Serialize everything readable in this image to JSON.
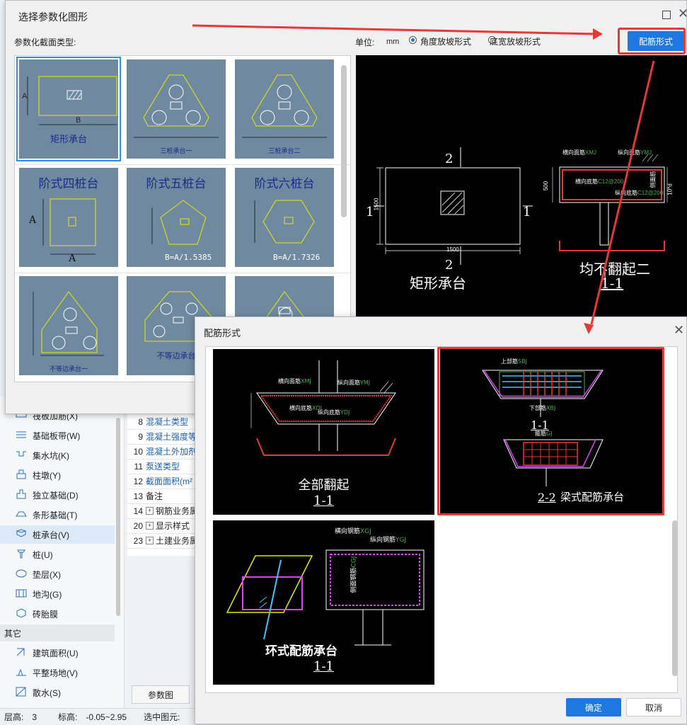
{
  "dialog1": {
    "title": "选择参数化图形",
    "section_type_label": "参数化截面类型:",
    "unit_label": "单位:",
    "unit_value": "mm",
    "radio_angle": "角度放坡形式",
    "radio_width": "底宽放坡形式",
    "rebar_button": "配筋形式",
    "thumbs": [
      {
        "label": "矩形承台",
        "dim_a": "A",
        "dim_b": "B"
      },
      {
        "label": "三桩承台一"
      },
      {
        "label": "三桩承台二"
      },
      {
        "label": "阶式四桩台",
        "dim": "A"
      },
      {
        "label": "阶式五桩台",
        "formula": "B=A/1.5385"
      },
      {
        "label": "阶式六桩台",
        "formula": "B=A/1.7326"
      },
      {
        "label": "不等边承台一"
      },
      {
        "label": "不等边承台"
      },
      {
        "label": ""
      }
    ],
    "preview": {
      "left_title": "矩形承台",
      "sec2_top": "2",
      "sec2_bottom": "2",
      "sec1_left": "1",
      "sec1_right": "1",
      "width_dim": "1500",
      "height_dim": "1500",
      "right_title": "均不翻起二",
      "right_sub": "1-1",
      "lbl_hmj": "横向面筋",
      "lbl_hmj_code": "XMJ",
      "lbl_zmj": "纵向面筋",
      "lbl_zmj_code": "YMJ",
      "lbl_hdj": "横向底筋",
      "lbl_hdj_code": "C12@200",
      "lbl_zdj": "纵向底筋",
      "lbl_zdj_code": "C12@200",
      "dim_500": "500",
      "dim_side": "侧面筋",
      "dim_10d": "10*d"
    }
  },
  "dialog2": {
    "title": "配筋形式",
    "ok": "确定",
    "cancel": "取消",
    "opt1": {
      "title": "全部翻起",
      "sub": "1-1",
      "lbl1": "横向面筋",
      "code1": "XMJ",
      "lbl2": "纵向面筋",
      "code2": "YMJ",
      "lbl3": "横向底筋",
      "code3": "XDJ",
      "lbl4": "纵向底筋",
      "code4": "YDJ"
    },
    "opt2": {
      "title": "梁式配筋承台",
      "sub1": "1-1",
      "sub2": "2-2",
      "lbl_top": "上部筋",
      "code_top": "SBJ",
      "lbl_bottom": "下部筋",
      "code_bottom": "XBJ",
      "lbl_tie": "箍筋",
      "code_tie": "GJ"
    },
    "opt3": {
      "title": "环式配筋承台",
      "sub": "1-1",
      "lbl1": "横向钢筋",
      "code1": "XGJ",
      "lbl2": "纵向钢筋",
      "code2": "YGJ",
      "lbl3": "侧面钢筋",
      "code3": "CGJ"
    }
  },
  "sidebar": {
    "items": [
      {
        "label": "筏板加筋(X)"
      },
      {
        "label": "基础板带(W)"
      },
      {
        "label": "集水坑(K)"
      },
      {
        "label": "柱墩(Y)"
      },
      {
        "label": "独立基础(D)"
      },
      {
        "label": "条形基础(T)"
      },
      {
        "label": "桩承台(V)"
      },
      {
        "label": "桩(U)"
      },
      {
        "label": "垫层(X)"
      },
      {
        "label": "地沟(G)"
      },
      {
        "label": "砖胎膜"
      }
    ],
    "group_other": "其它",
    "other_items": [
      {
        "label": "建筑面积(U)"
      },
      {
        "label": "平整场地(V)"
      },
      {
        "label": "散水(S)"
      }
    ]
  },
  "props": {
    "rows": [
      {
        "num": "8",
        "text": "混凝土类型"
      },
      {
        "num": "9",
        "text": "混凝土强度等"
      },
      {
        "num": "10",
        "text": "混凝土外加剂"
      },
      {
        "num": "11",
        "text": "泵送类型"
      },
      {
        "num": "12",
        "text": "截面面积(m²"
      },
      {
        "num": "13",
        "text": "备注"
      },
      {
        "num": "14",
        "text": "钢筋业务属"
      },
      {
        "num": "20",
        "text": "显示样式"
      },
      {
        "num": "23",
        "text": "土建业务属"
      }
    ],
    "param_button": "参数图"
  },
  "status": {
    "floor_label": "层高:",
    "floor_value": "3",
    "elev_label": "标高:",
    "elev_value": "-0.05~2.95",
    "sel_label": "选中图元:"
  },
  "colors": {
    "accent": "#1f78e0",
    "highlight": "#e53935",
    "thumb_bg": "#6f8aa0"
  }
}
